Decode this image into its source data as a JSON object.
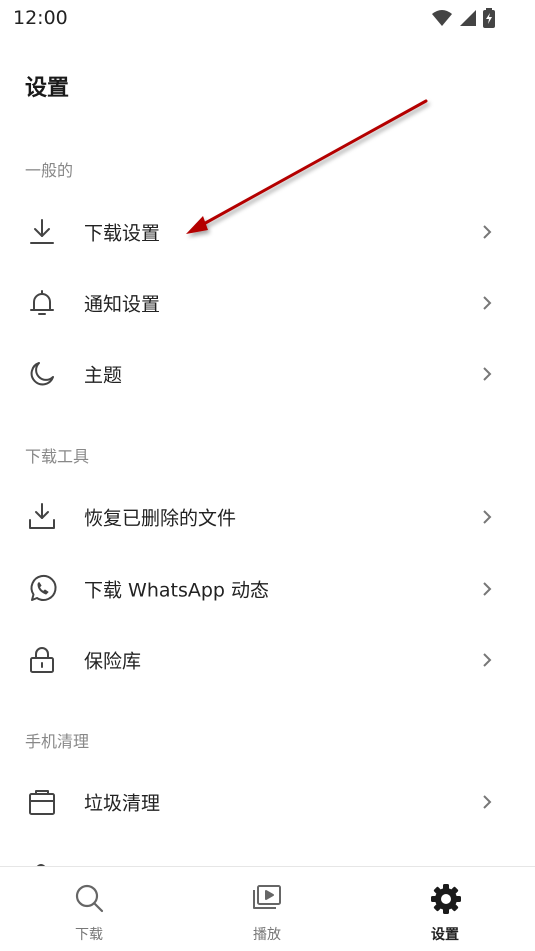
{
  "status_bar": {
    "time": "12:00"
  },
  "page": {
    "title": "设置"
  },
  "sections": [
    {
      "label": "一般的",
      "items": [
        {
          "label": "下载设置",
          "icon": "download-icon"
        },
        {
          "label": "通知设置",
          "icon": "bell-icon"
        },
        {
          "label": "主题",
          "icon": "moon-icon"
        }
      ]
    },
    {
      "label": "下载工具",
      "items": [
        {
          "label": "恢复已删除的文件",
          "icon": "restore-download-icon"
        },
        {
          "label": "下载 WhatsApp 动态",
          "icon": "whatsapp-icon"
        },
        {
          "label": "保险库",
          "icon": "lock-icon"
        }
      ]
    },
    {
      "label": "手机清理",
      "items": [
        {
          "label": "垃圾清理",
          "icon": "trash-clean-icon"
        }
      ]
    }
  ],
  "bottom_nav": [
    {
      "label": "下载",
      "icon": "search-icon",
      "active": false
    },
    {
      "label": "播放",
      "icon": "play-library-icon",
      "active": false
    },
    {
      "label": "设置",
      "icon": "gear-icon",
      "active": true
    }
  ],
  "colors": {
    "annotation_arrow": "#b40000",
    "section_label": "#888888",
    "active_nav": "#222222"
  }
}
